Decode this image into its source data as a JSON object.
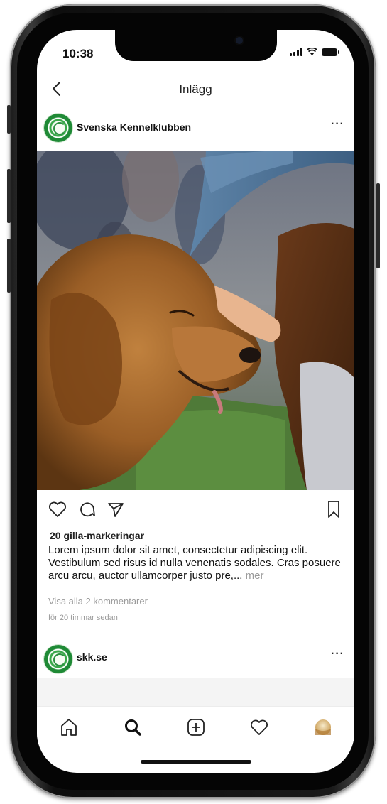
{
  "status_bar": {
    "time": "10:38"
  },
  "nav": {
    "title": "Inlägg"
  },
  "post": {
    "account_name": "Svenska Kennelklubben",
    "more_label": "···",
    "likes": "20 gilla-markeringar",
    "caption": "Lorem ipsum dolor sit amet, consectetur adipiscing elit. Vestibulum sed risus id nulla venenatis sodales. Cras posuere arcu arcu, auctor ullamcorper justo pre,...",
    "caption_more": "mer",
    "comments_link": "Visa alla 2 kommentarer",
    "timestamp": "för 20 timmar sedan"
  },
  "next_post": {
    "account_name": "skk.se",
    "more_label": "···"
  },
  "colors": {
    "logo_green": "#1f8a36",
    "muted_text": "#9b9b9b",
    "frame_dark": "#1a1a1a"
  },
  "icons": {
    "back": "chevron-left-icon",
    "like": "heart-icon",
    "comment": "comment-bubble-icon",
    "share": "paper-plane-icon",
    "save": "bookmark-icon",
    "tab_home": "home-icon",
    "tab_search": "search-icon",
    "tab_add": "plus-square-icon",
    "tab_activity": "heart-icon",
    "tab_profile": "profile-avatar"
  }
}
